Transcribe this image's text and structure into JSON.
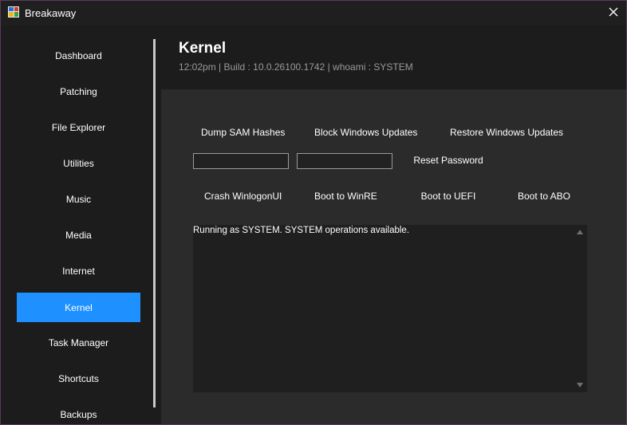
{
  "window": {
    "title": "Breakaway",
    "app_icon": "app-grid-icon",
    "close_icon": "close-icon",
    "border_color": "#5a3a5a"
  },
  "sidebar": {
    "items": [
      {
        "label": "Dashboard"
      },
      {
        "label": "Patching"
      },
      {
        "label": "File Explorer"
      },
      {
        "label": "Utilities"
      },
      {
        "label": "Music"
      },
      {
        "label": "Media"
      },
      {
        "label": "Internet"
      },
      {
        "label": "Kernel",
        "active": true
      },
      {
        "label": "Task Manager"
      },
      {
        "label": "Shortcuts"
      },
      {
        "label": "Backups"
      }
    ],
    "active_color": "#1e90ff"
  },
  "header": {
    "title": "Kernel",
    "subtitle": "12:02pm | Build : 10.0.26100.1742 | whoami : SYSTEM"
  },
  "actions": {
    "dump_sam": "Dump SAM Hashes",
    "block_updates": "Block Windows Updates",
    "restore_updates": "Restore Windows Updates",
    "reset_password": "Reset Password",
    "crash_winlogon": "Crash WinlogonUI",
    "boot_winre": "Boot to WinRE",
    "boot_uefi": "Boot to UEFI",
    "boot_abo": "Boot to ABO"
  },
  "fields": {
    "username_value": "",
    "password_value": ""
  },
  "output": {
    "text": "Running as SYSTEM. SYSTEM operations available."
  }
}
